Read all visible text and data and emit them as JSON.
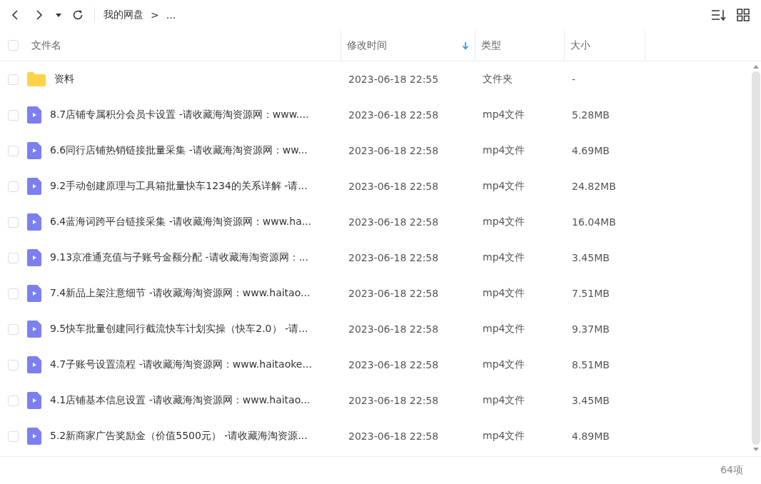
{
  "breadcrumb": {
    "root": "我的网盘",
    "separator": ">",
    "rest": "..."
  },
  "header": {
    "checked": false,
    "columns": [
      {
        "label": "文件名",
        "sorted": false
      },
      {
        "label": "修改时间",
        "sorted": true
      },
      {
        "label": "类型",
        "sorted": false
      },
      {
        "label": "大小",
        "sorted": false
      }
    ]
  },
  "rows": [
    {
      "kind": "folder",
      "checked": false,
      "name": "资料",
      "modified": "2023-06-18 22:55",
      "type": "文件夹",
      "size": "-"
    },
    {
      "kind": "video",
      "checked": false,
      "name": "8.7店铺专属积分会员卡设置 -请收藏海淘资源网：www....",
      "modified": "2023-06-18 22:58",
      "type": "mp4文件",
      "size": "5.28MB"
    },
    {
      "kind": "video",
      "checked": false,
      "name": "6.6同行店铺热销链接批量采集 -请收藏海淘资源网：ww...",
      "modified": "2023-06-18 22:58",
      "type": "mp4文件",
      "size": "4.69MB"
    },
    {
      "kind": "video",
      "checked": false,
      "name": "9.2手动创建原理与工具箱批量快车1234的关系详解 -请...",
      "modified": "2023-06-18 22:58",
      "type": "mp4文件",
      "size": "24.82MB"
    },
    {
      "kind": "video",
      "checked": false,
      "name": "6.4蓝海词跨平台链接采集 -请收藏海淘资源网：www.ha...",
      "modified": "2023-06-18 22:58",
      "type": "mp4文件",
      "size": "16.04MB"
    },
    {
      "kind": "video",
      "checked": false,
      "name": "9.13京准通充值与子账号金额分配 -请收藏海淘资源网：...",
      "modified": "2023-06-18 22:58",
      "type": "mp4文件",
      "size": "3.45MB"
    },
    {
      "kind": "video",
      "checked": false,
      "name": "7.4新品上架注意细节 -请收藏海淘资源网：www.haitao...",
      "modified": "2023-06-18 22:58",
      "type": "mp4文件",
      "size": "7.51MB"
    },
    {
      "kind": "video",
      "checked": false,
      "name": "9.5快车批量创建同行截流快车计划实操（快车2.0） -请...",
      "modified": "2023-06-18 22:58",
      "type": "mp4文件",
      "size": "9.37MB"
    },
    {
      "kind": "video",
      "checked": false,
      "name": "4.7子账号设置流程 -请收藏海淘资源网：www.haitaoke...",
      "modified": "2023-06-18 22:58",
      "type": "mp4文件",
      "size": "8.51MB"
    },
    {
      "kind": "video",
      "checked": false,
      "name": "4.1店铺基本信息设置 -请收藏海淘资源网：www.haitao...",
      "modified": "2023-06-18 22:58",
      "type": "mp4文件",
      "size": "3.45MB"
    },
    {
      "kind": "video",
      "checked": false,
      "name": "5.2新商家广告奖励金（价值5500元） -请收藏海淘资源...",
      "modified": "2023-06-18 22:58",
      "type": "mp4文件",
      "size": "4.89MB"
    }
  ],
  "status_bar": {
    "count": "64项"
  }
}
